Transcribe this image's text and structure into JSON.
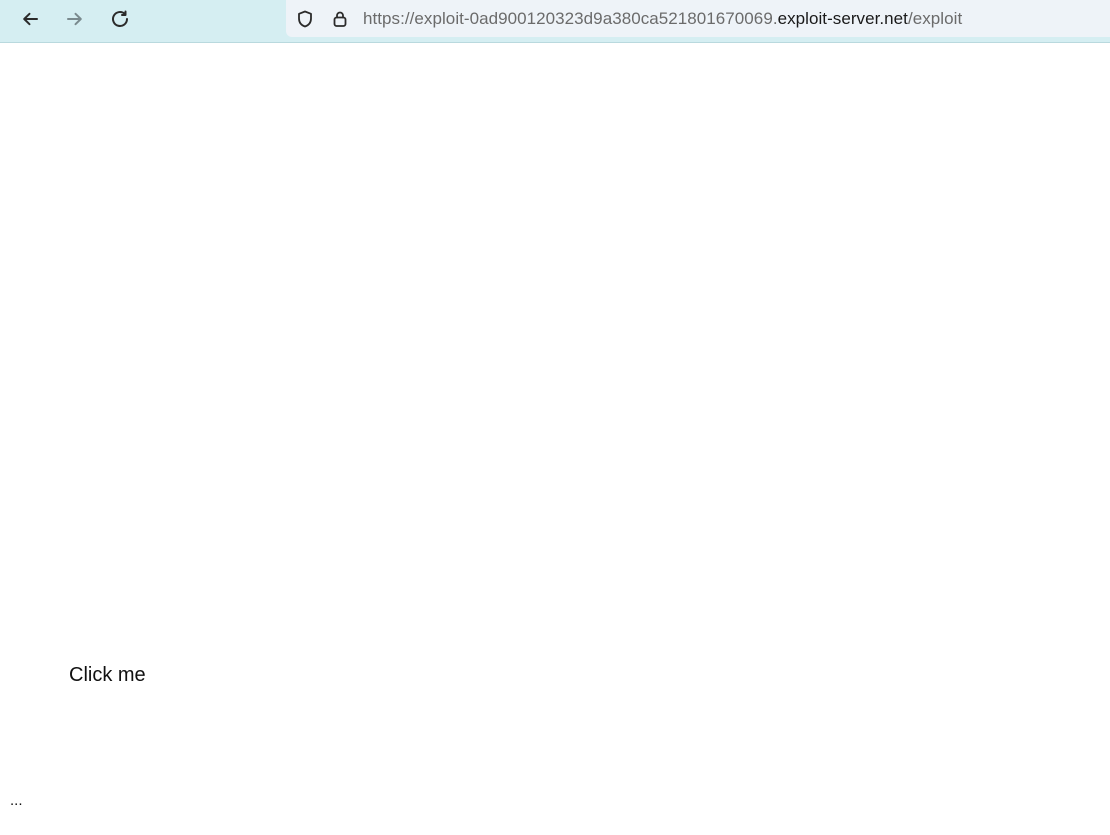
{
  "browser": {
    "toolbar": {
      "back_icon": "arrow-left-icon",
      "forward_icon": "arrow-right-icon",
      "reload_icon": "reload-icon",
      "shield_icon": "shield-icon",
      "lock_icon": "lock-icon"
    },
    "address": {
      "prefix": "https://exploit-0ad900120323d9a380ca521801670069.",
      "domain": "exploit-server.net",
      "path": "/exploit"
    },
    "colors": {
      "toolbar_background": "#d5eef2",
      "urlbar_background": "#eef3f8",
      "text_dim": "#6b6b6b",
      "text_dark": "#1a1a1a"
    }
  },
  "page": {
    "click_text": "Click me",
    "ellipsis": "..."
  }
}
